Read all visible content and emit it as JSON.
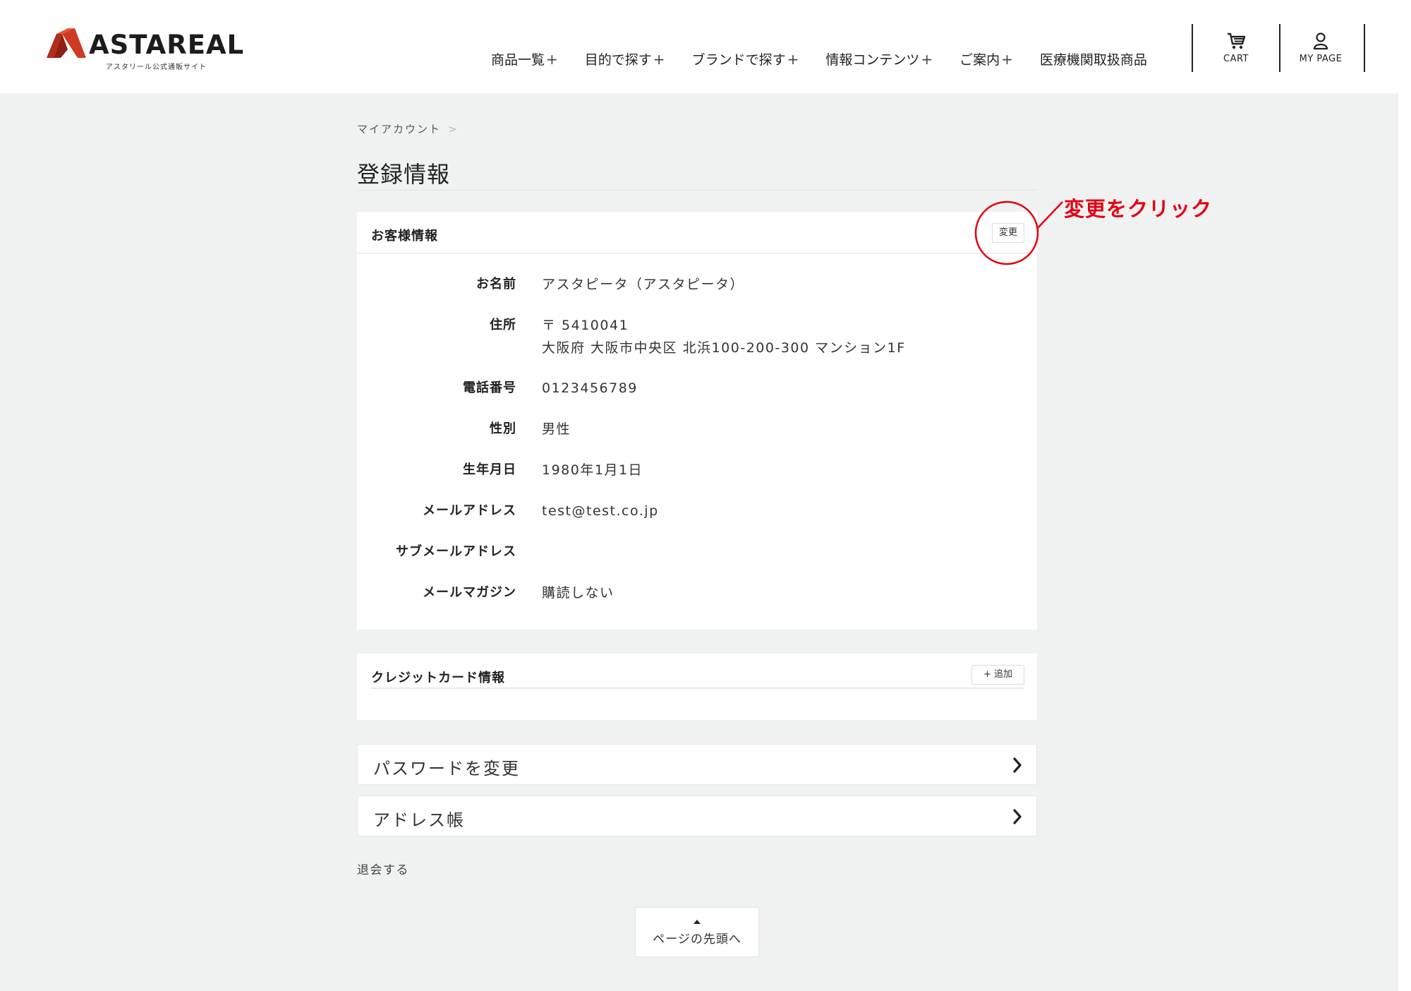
{
  "brand": {
    "name": "ASTAREAL",
    "tagline": "アスタリール公式通販サイト",
    "accent_color": "#c8321e"
  },
  "nav": {
    "items": [
      {
        "label": "商品一覧",
        "plus": "+"
      },
      {
        "label": "目的で探す",
        "plus": "+"
      },
      {
        "label": "ブランドで探す",
        "plus": "+"
      },
      {
        "label": "情報コンテンツ",
        "plus": "+"
      },
      {
        "label": "ご案内",
        "plus": "+"
      },
      {
        "label": "医療機関取扱商品",
        "plus": ""
      }
    ],
    "cart_label": "CART",
    "mypage_label": "MY PAGE"
  },
  "breadcrumb": {
    "item": "マイアカウント",
    "separator": ">"
  },
  "page": {
    "title": "登録情報"
  },
  "customer_card": {
    "title": "お客様情報",
    "edit_label": "変更",
    "rows": [
      {
        "label": "お名前",
        "value": "アスタピータ（アスタピータ）"
      },
      {
        "label": "住所",
        "value": "〒 5410041",
        "value2": "大阪府 大阪市中央区 北浜100-200-300 マンション1F"
      },
      {
        "label": "電話番号",
        "value": "0123456789"
      },
      {
        "label": "性別",
        "value": "男性"
      },
      {
        "label": "生年月日",
        "value": "1980年1月1日"
      },
      {
        "label": "メールアドレス",
        "value": "test@test.co.jp"
      },
      {
        "label": "サブメールアドレス",
        "value": ""
      },
      {
        "label": "メールマガジン",
        "value": "購読しない"
      }
    ]
  },
  "credit_card": {
    "title": "クレジットカード情報",
    "add_label": "+ 追加"
  },
  "links": {
    "password": "パスワードを変更",
    "address_book": "アドレス帳"
  },
  "withdraw_label": "退会する",
  "to_top_label": "ページの先頭へ",
  "annotation": {
    "text": "変更をクリック",
    "color": "#e60012"
  }
}
